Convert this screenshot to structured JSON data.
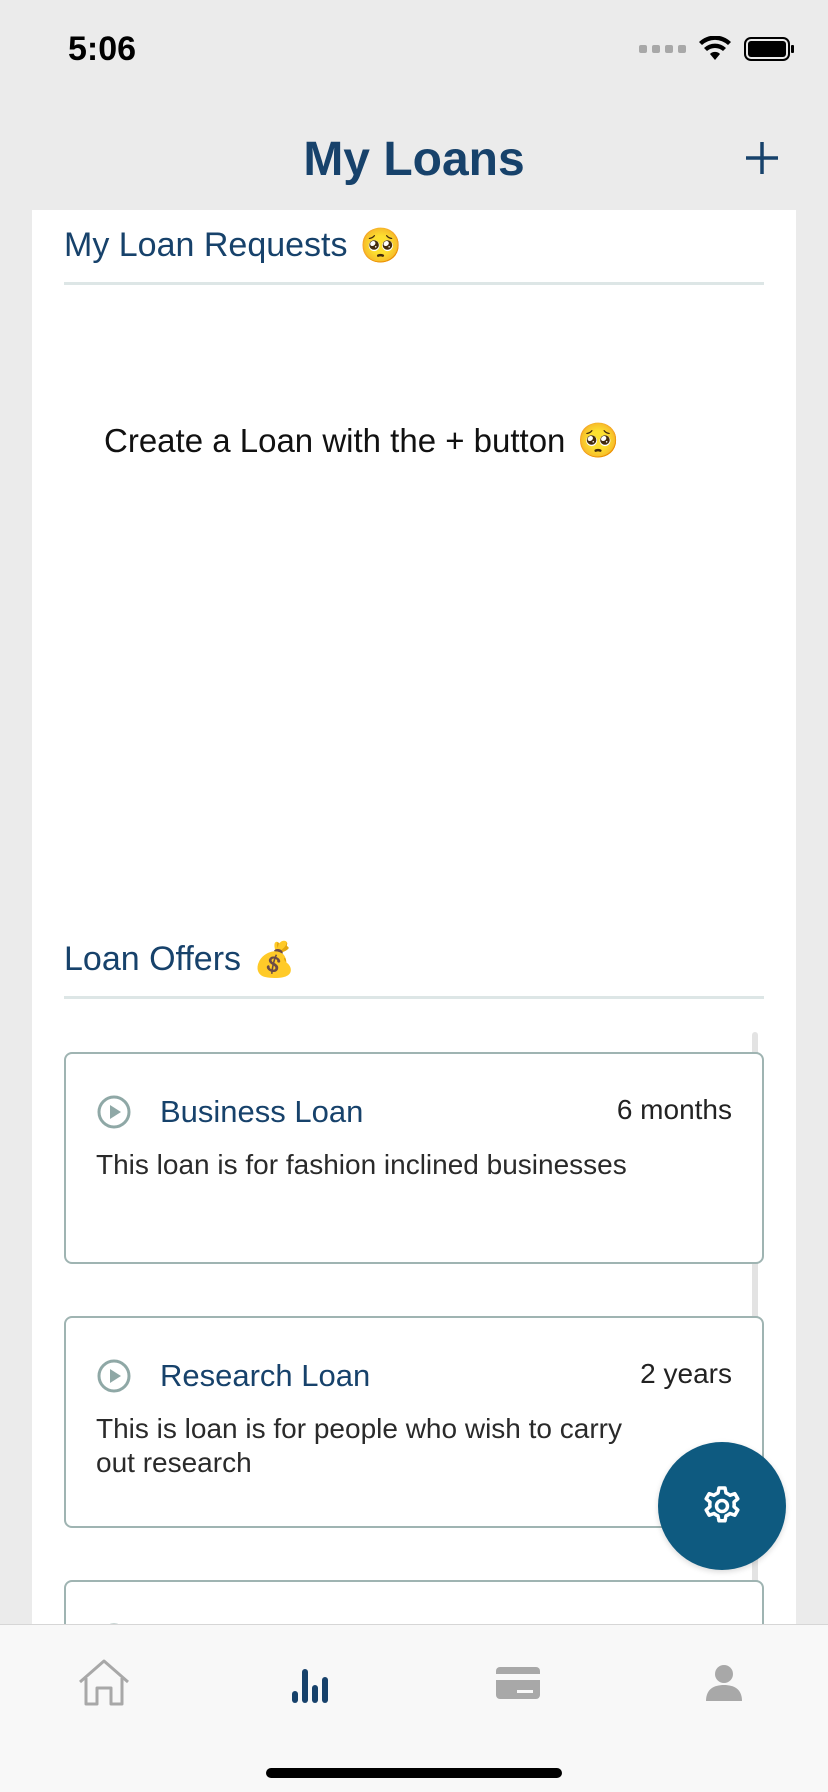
{
  "status_bar": {
    "time": "5:06",
    "icons": [
      "signal-icon",
      "wifi-icon",
      "battery-icon"
    ]
  },
  "header": {
    "title": "My Loans",
    "add_icon": "plus-icon"
  },
  "loan_requests": {
    "heading": "My Loan Requests",
    "heading_emoji": "🥺",
    "empty_message": "Create a Loan with the + button",
    "empty_emoji": "🥺"
  },
  "loan_offers": {
    "heading": "Loan Offers",
    "heading_emoji": "💰",
    "items": [
      {
        "name": "Business Loan",
        "term": "6 months",
        "description": "This loan is for fashion inclined businesses"
      },
      {
        "name": "Research Loan",
        "term": "2 years",
        "description": "This is loan is for people who wish to carry out research"
      }
    ]
  },
  "fab": {
    "icon": "gear-icon"
  },
  "tab_bar": {
    "tabs": [
      {
        "icon": "home-icon",
        "active": false
      },
      {
        "icon": "chart-icon",
        "active": true
      },
      {
        "icon": "card-icon",
        "active": false
      },
      {
        "icon": "profile-icon",
        "active": false
      }
    ]
  },
  "colors": {
    "brand": "#17426b",
    "fab": "#0e5a80",
    "card_border": "#9fb4b2",
    "inactive_icon": "#a8a8a8"
  }
}
